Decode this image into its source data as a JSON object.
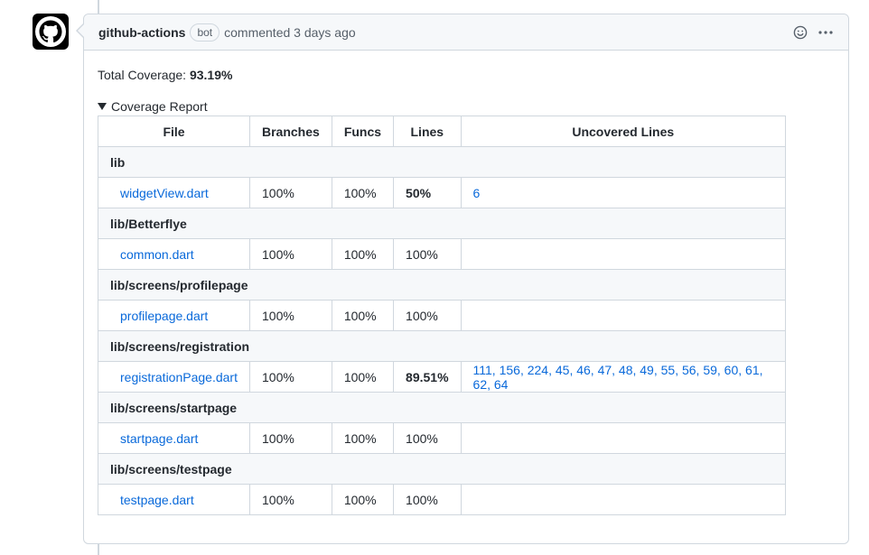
{
  "comment": {
    "author": "github-actions",
    "bot_label": "bot",
    "meta": "commented 3 days ago",
    "actions": [
      "smiley-icon",
      "kebab-horizontal-icon"
    ]
  },
  "body": {
    "total_label": "Total Coverage:",
    "total_value": "93.19%",
    "details_summary": "Coverage Report"
  },
  "table": {
    "headers": [
      "File",
      "Branches",
      "Funcs",
      "Lines",
      "Uncovered Lines"
    ],
    "groups": [
      {
        "name": "lib",
        "file": "widgetView.dart",
        "branches": "100%",
        "funcs": "100%",
        "lines": "50%",
        "lines_bold": true,
        "uncovered": "6"
      },
      {
        "name": "lib/Betterflye",
        "file": "common.dart",
        "branches": "100%",
        "funcs": "100%",
        "lines": "100%",
        "lines_bold": false,
        "uncovered": ""
      },
      {
        "name": "lib/screens/profilepage",
        "file": "profilepage.dart",
        "branches": "100%",
        "funcs": "100%",
        "lines": "100%",
        "lines_bold": false,
        "uncovered": ""
      },
      {
        "name": "lib/screens/registration",
        "file": "registrationPage.dart",
        "branches": "100%",
        "funcs": "100%",
        "lines": "89.51%",
        "lines_bold": true,
        "uncovered": "111, 156, 224, 45, 46, 47, 48, 49, 55, 56, 59, 60, 61, 62, 64"
      },
      {
        "name": "lib/screens/startpage",
        "file": "startpage.dart",
        "branches": "100%",
        "funcs": "100%",
        "lines": "100%",
        "lines_bold": false,
        "uncovered": ""
      },
      {
        "name": "lib/screens/testpage",
        "file": "testpage.dart",
        "branches": "100%",
        "funcs": "100%",
        "lines": "100%",
        "lines_bold": false,
        "uncovered": ""
      }
    ]
  }
}
